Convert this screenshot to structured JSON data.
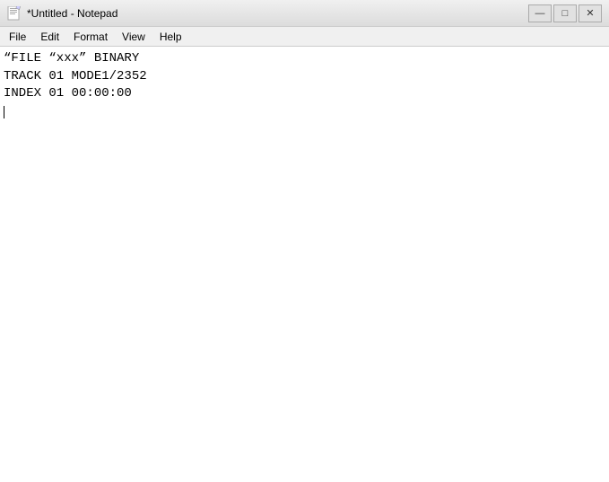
{
  "titleBar": {
    "title": "*Untitled - Notepad",
    "iconAlt": "notepad-icon",
    "buttons": {
      "minimize": "—",
      "maximize": "□",
      "close": "✕"
    }
  },
  "menuBar": {
    "items": [
      {
        "id": "file",
        "label": "File"
      },
      {
        "id": "edit",
        "label": "Edit"
      },
      {
        "id": "format",
        "label": "Format"
      },
      {
        "id": "view",
        "label": "View"
      },
      {
        "id": "help",
        "label": "Help"
      }
    ]
  },
  "editor": {
    "lines": [
      "“FILE “xxx” BINARY",
      "TRACK 01 MODE1/2352",
      "INDEX 01 00:00:00",
      ""
    ]
  }
}
